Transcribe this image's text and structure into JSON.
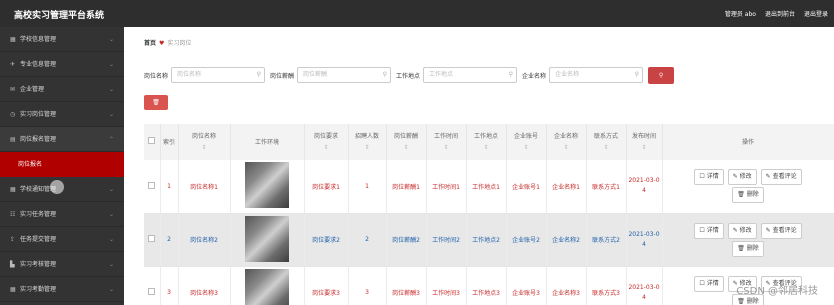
{
  "header": {
    "title": "高校实习管理平台系统",
    "admin": "管理员 abo",
    "front": "退出到前台",
    "logout": "退出登录"
  },
  "sidebar": {
    "items": [
      {
        "icon": "▦",
        "label": "学校信息管理"
      },
      {
        "icon": "✈",
        "label": "专业信息管理"
      },
      {
        "icon": "✉",
        "label": "企业管理"
      },
      {
        "icon": "◷",
        "label": "实习岗位管理"
      },
      {
        "icon": "▤",
        "label": "岗位报名管理"
      },
      {
        "icon": "▦",
        "label": "学校通知管理"
      },
      {
        "icon": "☷",
        "label": "实习任务管理"
      },
      {
        "icon": "⇪",
        "label": "任务提交管理"
      },
      {
        "icon": "▙",
        "label": "实习考核管理"
      },
      {
        "icon": "▦",
        "label": "实习考勤管理"
      }
    ],
    "sub": "岗位报名"
  },
  "breadcrumb": {
    "home": "首页",
    "heart": "♥",
    "current": "实习岗位"
  },
  "search": {
    "f1_label": "岗位名称",
    "f1_ph": "岗位名称",
    "f2_label": "岗位薪酬",
    "f2_ph": "岗位薪酬",
    "f3_label": "工作地点",
    "f3_ph": "工作地点",
    "f4_label": "企业名称",
    "f4_ph": "企业名称",
    "icon": "⚲"
  },
  "delete_icon": "🗑",
  "table": {
    "headers": [
      "索引",
      "岗位名称",
      "工作环境",
      "岗位要求",
      "招聘人数",
      "岗位薪酬",
      "工作时间",
      "工作地点",
      "企业账号",
      "企业名称",
      "联系方式",
      "发布时间",
      "操作"
    ],
    "sort": "⇕",
    "rows": [
      {
        "index": "1",
        "name": "岗位名称1",
        "req": "岗位要求1",
        "num": "1",
        "pay": "岗位薪酬1",
        "time": "工作时间1",
        "place": "工作地点1",
        "acct": "企业账号1",
        "company": "企业名称1",
        "contact": "联系方式1",
        "date": "2021-03-0\n4"
      },
      {
        "index": "2",
        "name": "岗位名称2",
        "req": "岗位要求2",
        "num": "2",
        "pay": "岗位薪酬2",
        "time": "工作时间2",
        "place": "工作地点2",
        "acct": "企业账号2",
        "company": "企业名称2",
        "contact": "联系方式2",
        "date": "2021-03-0\n4"
      },
      {
        "index": "3",
        "name": "岗位名称3",
        "req": "岗位要求3",
        "num": "3",
        "pay": "岗位薪酬3",
        "time": "工作时间3",
        "place": "工作地点3",
        "acct": "企业账号3",
        "company": "企业名称3",
        "contact": "联系方式3",
        "date": "2021-03-0\n4"
      }
    ],
    "ops": {
      "detail": "☐ 详情",
      "edit": "✎ 修改",
      "review": "✎ 查看评论",
      "delete": "🗑 删除"
    }
  },
  "watermark": "CSDN @邻居科技",
  "colors": {
    "topbar": "#2e2e2e",
    "sidebar": "#333333",
    "active_sub": "#b00000",
    "accent": "#c94344"
  }
}
